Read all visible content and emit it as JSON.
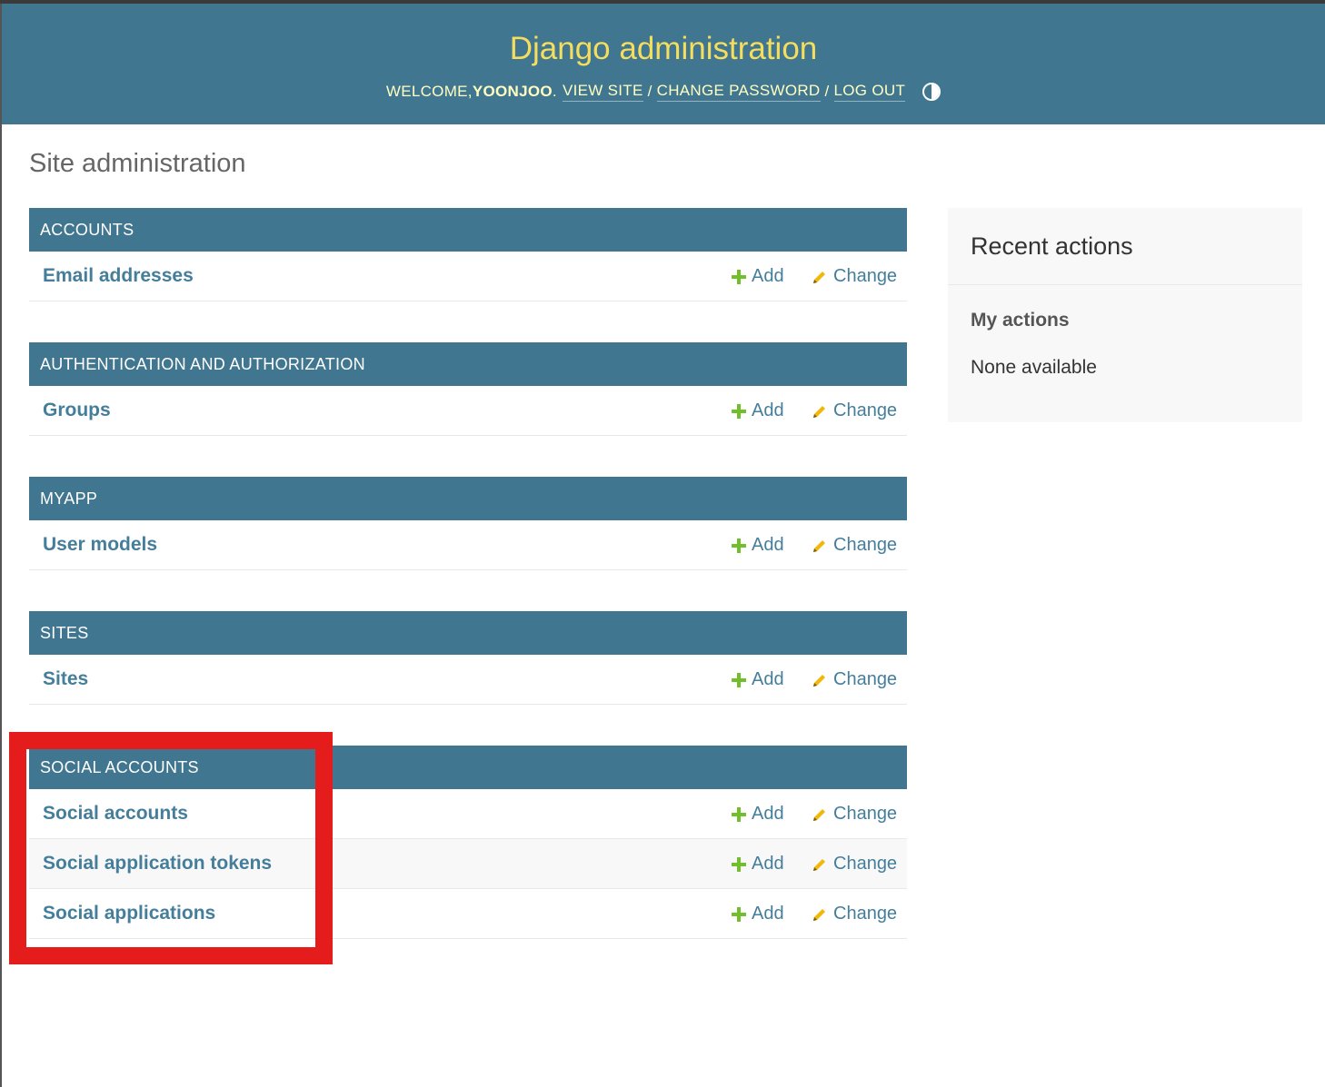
{
  "header": {
    "branding": "Django administration",
    "welcome_prefix": "WELCOME, ",
    "username": "YOONJOO",
    "username_suffix": ".",
    "view_site": "VIEW SITE",
    "change_password": "CHANGE PASSWORD",
    "log_out": "LOG OUT",
    "separator": "/",
    "theme_icon": "contrast-toggle-icon"
  },
  "page_title": "Site administration",
  "modules": [
    {
      "caption": "ACCOUNTS",
      "models": [
        {
          "name": "Email addresses",
          "add": "Add",
          "change": "Change"
        }
      ]
    },
    {
      "caption": "AUTHENTICATION AND AUTHORIZATION",
      "models": [
        {
          "name": "Groups",
          "add": "Add",
          "change": "Change"
        }
      ]
    },
    {
      "caption": "MYAPP",
      "models": [
        {
          "name": "User models",
          "add": "Add",
          "change": "Change"
        }
      ]
    },
    {
      "caption": "SITES",
      "models": [
        {
          "name": "Sites",
          "add": "Add",
          "change": "Change"
        }
      ]
    },
    {
      "caption": "SOCIAL ACCOUNTS",
      "models": [
        {
          "name": "Social accounts",
          "add": "Add",
          "change": "Change"
        },
        {
          "name": "Social application tokens",
          "add": "Add",
          "change": "Change"
        },
        {
          "name": "Social applications",
          "add": "Add",
          "change": "Change"
        }
      ]
    }
  ],
  "recent_actions": {
    "title": "Recent actions",
    "my_actions": "My actions",
    "empty": "None available"
  },
  "colors": {
    "header_bg": "#417690",
    "branding": "#f5dd5d",
    "link": "#447e9b",
    "add_icon": "#70bf2b",
    "change_icon": "#efb80b",
    "highlight": "#e51c1c"
  }
}
